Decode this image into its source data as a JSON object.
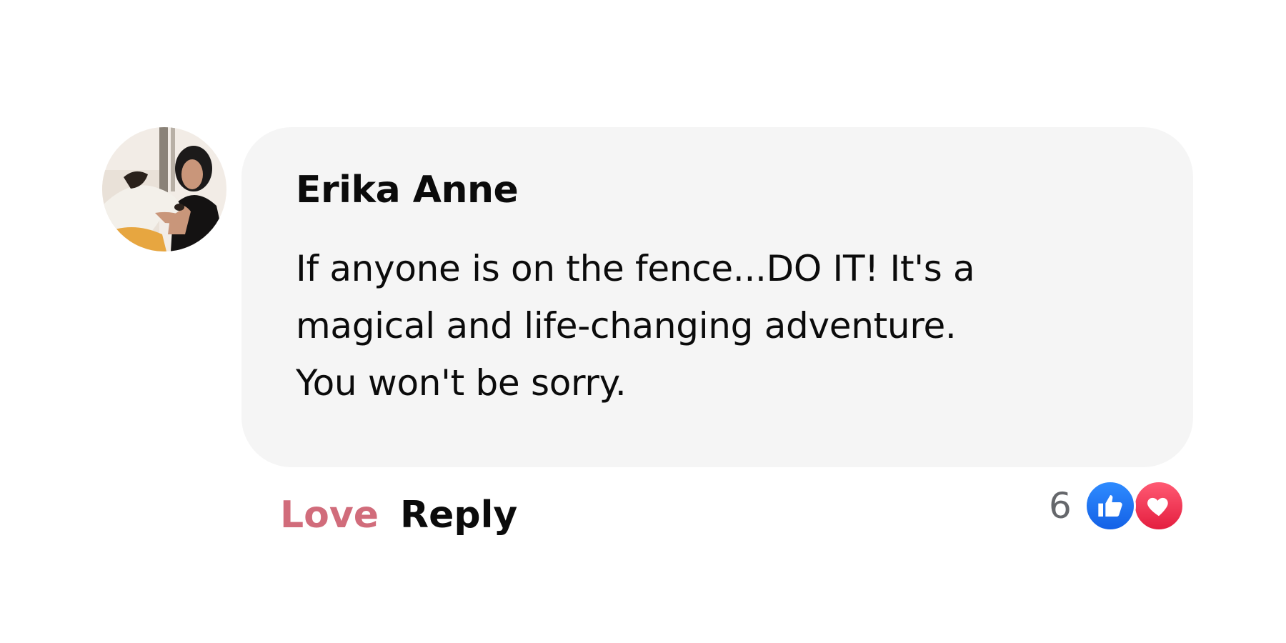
{
  "comment": {
    "author": "Erika Anne",
    "text_lines": [
      "If anyone is on the fence...DO IT! It's a",
      "magical and life-changing adventure.",
      "You won't be sorry."
    ],
    "avatar_icon": "profile-photo-woman-with-dog"
  },
  "actions": {
    "love_label": "Love",
    "reply_label": "Reply"
  },
  "reactions": {
    "count": "6",
    "icons": [
      "like-icon",
      "heart-icon"
    ],
    "colors": {
      "like": "#1877f2",
      "heart": "#f02849",
      "love_action": "#d16c7b"
    }
  }
}
